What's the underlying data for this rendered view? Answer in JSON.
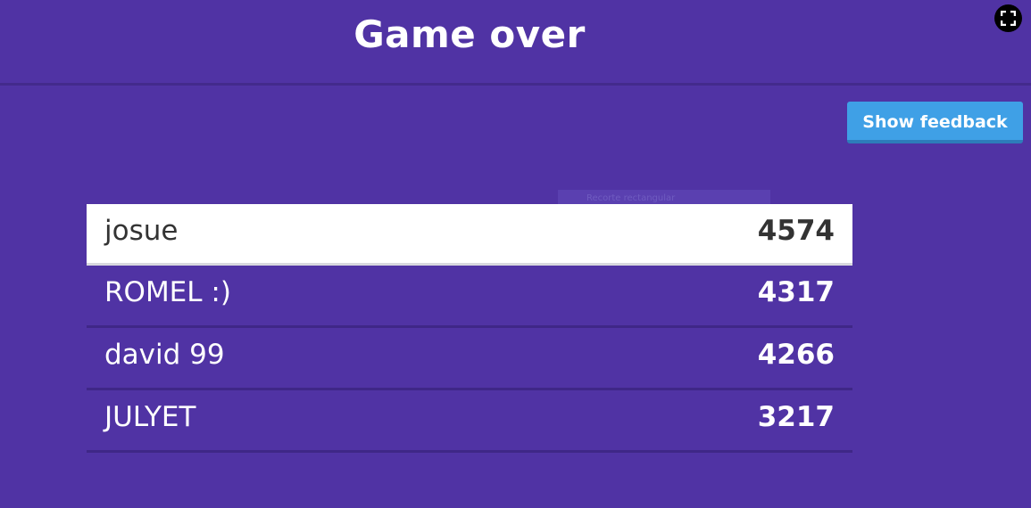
{
  "header": {
    "title": "Game over"
  },
  "controls": {
    "feedback_label": "Show feedback",
    "fullscreen_icon": "expand-icon"
  },
  "overlay": {
    "label": "Recorte rectangular"
  },
  "leaderboard": [
    {
      "name": "josue",
      "score": "4574"
    },
    {
      "name": "ROMEL :)",
      "score": "4317"
    },
    {
      "name": "david 99",
      "score": "4266"
    },
    {
      "name": "JULYET",
      "score": "3217"
    }
  ],
  "colors": {
    "background": "#5033a4",
    "button": "#3fa0e6",
    "highlight_row": "#ffffff"
  }
}
